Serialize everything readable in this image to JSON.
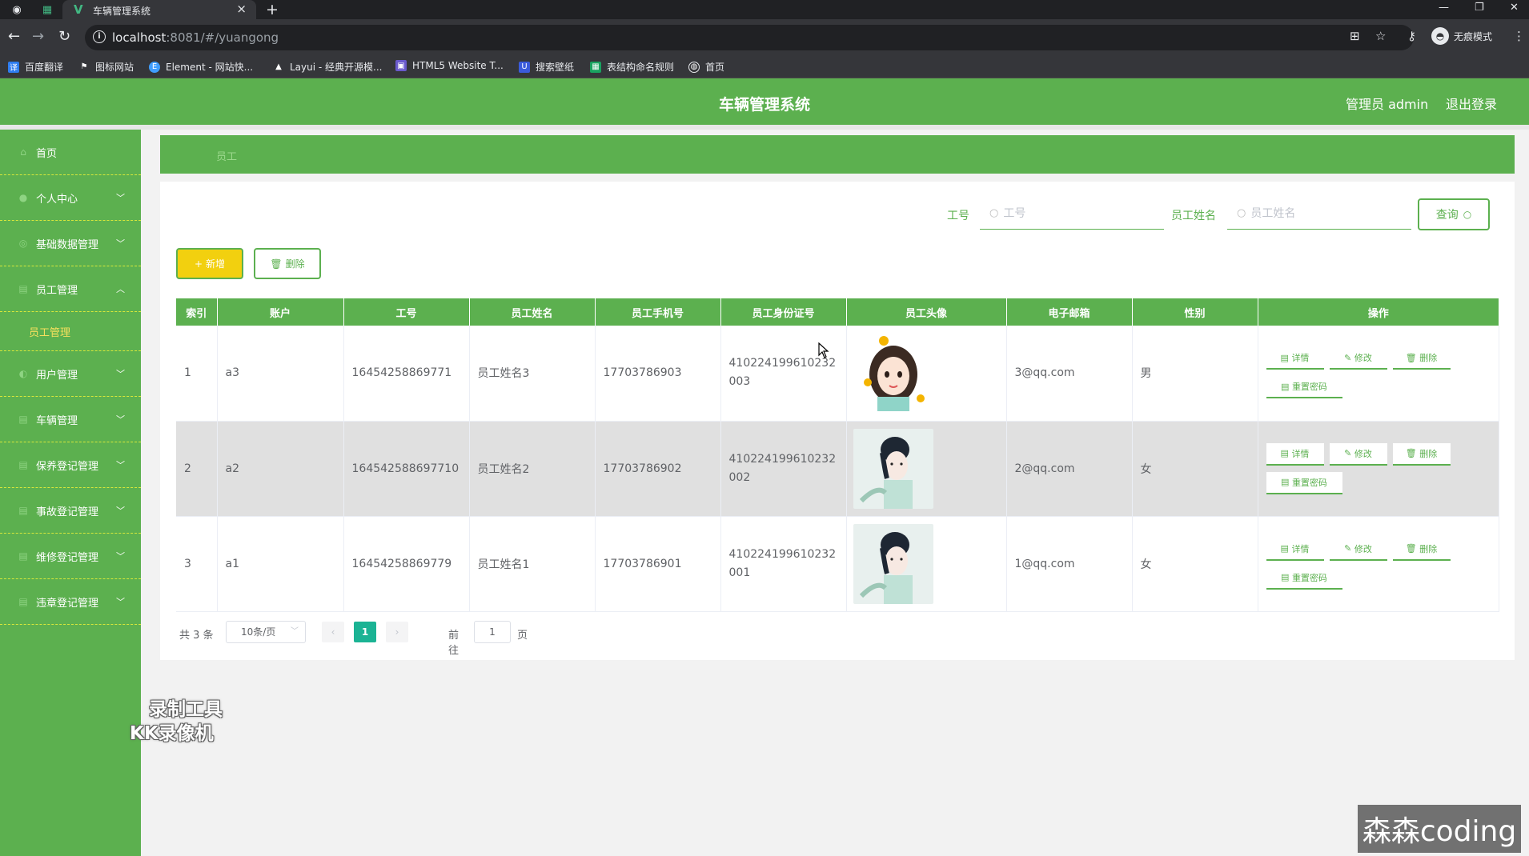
{
  "browser": {
    "tab_title": "车辆管理系统",
    "url_host": "localhost",
    "url_path": ":8081/#/yuangong",
    "incognito_label": "无痕模式",
    "bookmarks": [
      "百度翻译",
      "图标网站",
      "Element - 网站快...",
      "Layui - 经典开源模...",
      "HTML5 Website T...",
      "搜索壁纸",
      "表结构命名规则",
      "首页"
    ]
  },
  "header": {
    "title": "车辆管理系统",
    "user": "管理员 admin",
    "logout": "退出登录"
  },
  "sidebar": {
    "items": [
      {
        "label": "首页",
        "icon": "home-icon",
        "arrow": ""
      },
      {
        "label": "个人中心",
        "icon": "user-icon",
        "arrow": "﹀"
      },
      {
        "label": "基础数据管理",
        "icon": "settings-icon",
        "arrow": "﹀"
      },
      {
        "label": "员工管理",
        "icon": "table-icon",
        "arrow": "︿"
      },
      {
        "label": "用户管理",
        "icon": "users-icon",
        "arrow": "﹀"
      },
      {
        "label": "车辆管理",
        "icon": "car-icon",
        "arrow": "﹀"
      },
      {
        "label": "保养登记管理",
        "icon": "table-icon",
        "arrow": "﹀"
      },
      {
        "label": "事故登记管理",
        "icon": "table-icon",
        "arrow": "﹀"
      },
      {
        "label": "维修登记管理",
        "icon": "table-icon",
        "arrow": "﹀"
      },
      {
        "label": "违章登记管理",
        "icon": "table-icon",
        "arrow": "﹀"
      }
    ],
    "sub_item": "员工管理"
  },
  "breadcrumb": "员工",
  "search": {
    "field1_label": "工号",
    "field1_placeholder": "工号",
    "field2_label": "员工姓名",
    "field2_placeholder": "员工姓名",
    "query_button": "查询"
  },
  "actions": {
    "add": "新增",
    "delete": "删除"
  },
  "table": {
    "columns": [
      "索引",
      "账户",
      "工号",
      "员工姓名",
      "员工手机号",
      "员工身份证号",
      "员工头像",
      "电子邮箱",
      "性别",
      "操作"
    ],
    "rows": [
      {
        "index": "1",
        "account": "a3",
        "job_no": "16454258869771",
        "name": "员工姓名3",
        "phone": "17703786903",
        "id_card": "410224199610232003",
        "email": "3@qq.com",
        "gender": "男"
      },
      {
        "index": "2",
        "account": "a2",
        "job_no": "164542588697710",
        "name": "员工姓名2",
        "phone": "17703786902",
        "id_card": "410224199610232002",
        "email": "2@qq.com",
        "gender": "女"
      },
      {
        "index": "3",
        "account": "a1",
        "job_no": "16454258869779",
        "name": "员工姓名1",
        "phone": "17703786901",
        "id_card": "410224199610232001",
        "email": "1@qq.com",
        "gender": "女"
      }
    ],
    "row_ops": {
      "detail": "详情",
      "edit": "修改",
      "delete": "删除",
      "reset_pwd": "重置密码"
    }
  },
  "pagination": {
    "total": "共 3 条",
    "page_size": "10条/页",
    "current": "1",
    "goto_label": "前往",
    "goto_value": "1",
    "page_suffix": "页"
  },
  "overlays": {
    "recorder_line1": "录制工具",
    "recorder_line2": "KK录像机",
    "channel": "森森coding"
  },
  "colors": {
    "primary_green": "#5cb04f",
    "add_button_yellow": "#f2d00f",
    "pager_current": "#1bb394"
  }
}
